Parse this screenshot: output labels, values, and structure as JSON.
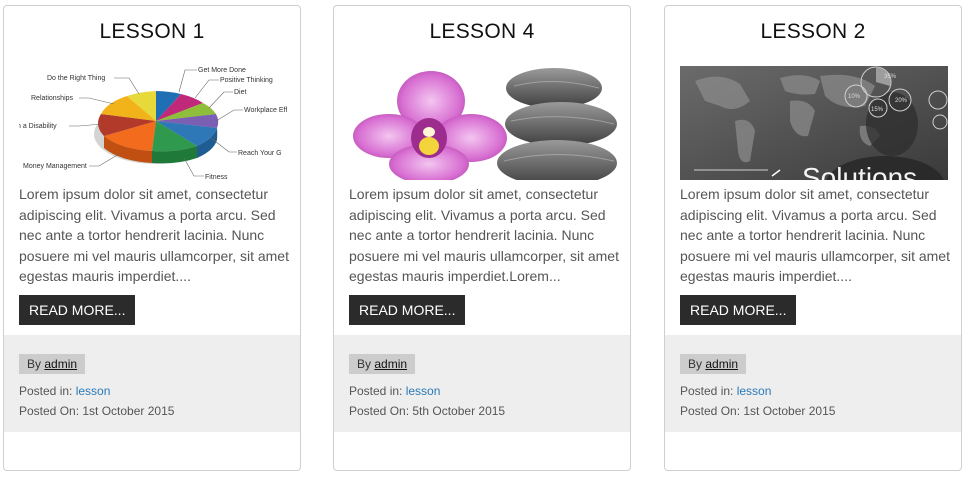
{
  "cards": [
    {
      "title": "LESSON 1",
      "image": "pie-chart-image",
      "image_labels": [
        "Get More Done",
        "Positive Thinking",
        "Diet",
        "Workplace Eff",
        "Reach Your G",
        "Fitness",
        "Money Management",
        "h a Disability",
        "Relationships",
        "Do the Right Thing"
      ],
      "excerpt": "Lorem ipsum dolor sit amet, consectetur adipiscing elit. Vivamus a porta arcu. Sed nec ante a tortor hendrerit lacinia. Nunc posuere mi vel mauris ullamcorper, sit amet egestas mauris imperdiet....",
      "button": "READ MORE...",
      "by_label": "By",
      "author": "admin",
      "posted_in_label": "Posted in:",
      "category": "lesson",
      "posted_on": "Posted On: 1st October 2015"
    },
    {
      "title": "LESSON 4",
      "image": "orchid-stones-image",
      "excerpt": "Lorem ipsum dolor sit amet, consectetur adipiscing elit. Vivamus a porta arcu. Sed nec ante a tortor hendrerit lacinia. Nunc posuere mi vel mauris ullamcorper, sit amet egestas mauris imperdiet.Lorem...",
      "button": "READ MORE...",
      "by_label": "By",
      "author": "admin",
      "posted_in_label": "Posted in:",
      "category": "lesson",
      "posted_on": "Posted On: 5th October 2015"
    },
    {
      "title": "LESSON 2",
      "image": "solutions-map-image",
      "image_text": "Solutions",
      "image_labels": [
        "35%",
        "10%",
        "20%",
        "15%"
      ],
      "excerpt": "Lorem ipsum dolor sit amet, consectetur adipiscing elit. Vivamus a porta arcu. Sed nec ante a tortor hendrerit lacinia. Nunc posuere mi vel mauris ullamcorper, sit amet egestas mauris imperdiet....",
      "button": "READ MORE...",
      "by_label": "By",
      "author": "admin",
      "posted_in_label": "Posted in:",
      "category": "lesson",
      "posted_on": "Posted On: 1st October 2015"
    }
  ],
  "colors": {
    "button_bg": "#2b2b2b",
    "meta_bg": "#eeeeee",
    "author_badge_bg": "#cccccc",
    "link": "#2a7ab8"
  }
}
